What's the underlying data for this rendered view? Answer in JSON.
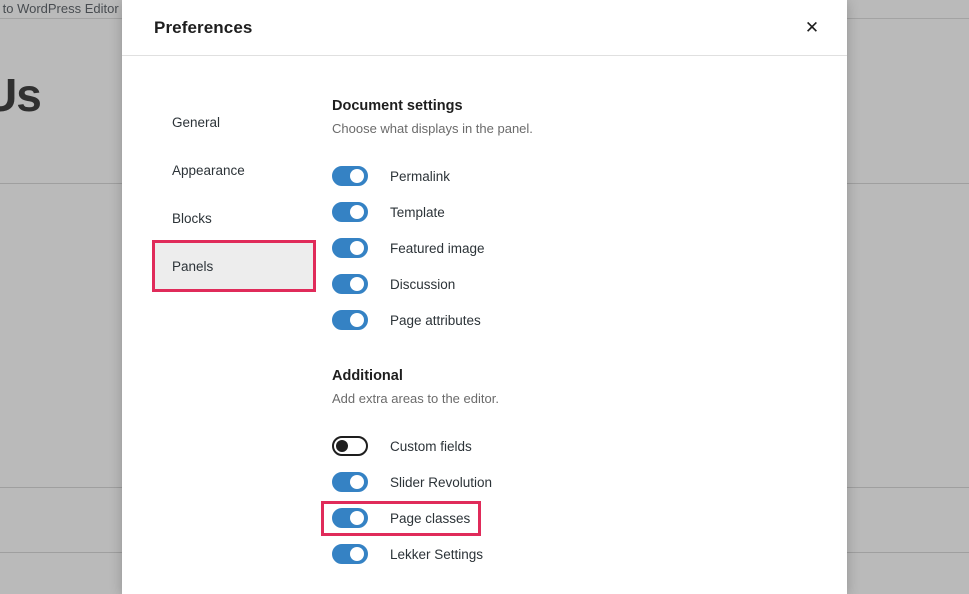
{
  "background": {
    "topbar_text": "ck to WordPress Editor",
    "page_heading": "Us",
    "overlay_color": "#5a5a5a"
  },
  "modal": {
    "title": "Preferences",
    "close_label": "✕",
    "close_icon": "close-icon"
  },
  "nav": {
    "items": [
      {
        "label": "General",
        "selected": false,
        "highlighted": false
      },
      {
        "label": "Appearance",
        "selected": false,
        "highlighted": false
      },
      {
        "label": "Blocks",
        "selected": false,
        "highlighted": false
      },
      {
        "label": "Panels",
        "selected": true,
        "highlighted": true
      }
    ]
  },
  "sections": [
    {
      "title": "Document settings",
      "description": "Choose what displays in the panel.",
      "toggles": [
        {
          "label": "Permalink",
          "state": "on",
          "highlighted": false
        },
        {
          "label": "Template",
          "state": "on",
          "highlighted": false
        },
        {
          "label": "Featured image",
          "state": "on",
          "highlighted": false
        },
        {
          "label": "Discussion",
          "state": "on",
          "highlighted": false
        },
        {
          "label": "Page attributes",
          "state": "on",
          "highlighted": false
        }
      ]
    },
    {
      "title": "Additional",
      "description": "Add extra areas to the editor.",
      "toggles": [
        {
          "label": "Custom fields",
          "state": "off",
          "highlighted": false
        },
        {
          "label": "Slider Revolution",
          "state": "on",
          "highlighted": false
        },
        {
          "label": "Page classes",
          "state": "on",
          "highlighted": true
        },
        {
          "label": "Lekker Settings",
          "state": "on",
          "highlighted": false
        }
      ]
    }
  ],
  "colors": {
    "toggle_on": "#3582c4",
    "toggle_off_border": "#1e1e1e",
    "highlight": "#e02b5a",
    "selected_bg": "#ededed"
  }
}
